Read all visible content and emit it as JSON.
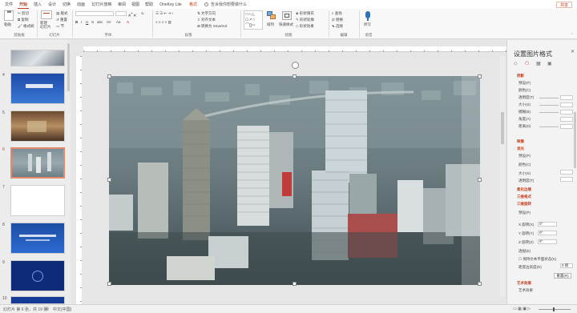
{
  "tabs": [
    "文件",
    "开始",
    "插入",
    "设计",
    "切换",
    "动画",
    "幻灯片放映",
    "审阅",
    "视图",
    "帮助",
    "OneKey Lite",
    "格式"
  ],
  "tell_me": "告诉我你想要做什么",
  "share": "共享",
  "ribbon": {
    "paste": "粘贴",
    "cut": "剪切",
    "copy": "复制",
    "format_painter": "格式刷",
    "new_slide": "新建\n幻灯片",
    "layout": "版式",
    "reset": "重置",
    "section": "节",
    "text_direction": "文字方向",
    "align_text": "对齐文本",
    "to_smartart": "转换为 SmartArt",
    "arrange": "排列",
    "quick_styles": "快速样式",
    "shape_fill": "形状填充",
    "shape_outline": "形状轮廓",
    "shape_effects": "形状效果",
    "find": "查找",
    "replace": "替换",
    "select": "选择",
    "dictate": "听写",
    "groups": {
      "clipboard": "剪贴板",
      "slides": "幻灯片",
      "font": "字体",
      "paragraph": "段落",
      "drawing": "绘图",
      "editing": "编辑",
      "voice": "语音"
    }
  },
  "slides": [
    {
      "num": "4"
    },
    {
      "num": "5"
    },
    {
      "num": "6"
    },
    {
      "num": "7"
    },
    {
      "num": "8"
    },
    {
      "num": "9"
    },
    {
      "num": "10"
    }
  ],
  "pane": {
    "title": "设置图片格式",
    "shadow": "阴影",
    "preset": "预设(P)",
    "color": "颜色(C)",
    "transparency": "透明度(T)",
    "size": "大小(S)",
    "blur": "模糊(B)",
    "angle": "角度(A)",
    "distance": "距离(D)",
    "reflection": "映像",
    "glow": "发光",
    "glow_preset": "预设(P)",
    "glow_color": "颜色(C)",
    "glow_size": "大小(S)",
    "glow_transparency": "透明度(T)",
    "soft_edges": "柔化边缘",
    "format3d": "三维格式",
    "rotation3d": "三维旋转",
    "rot_preset": "预设(P)",
    "x_rotation": "X 旋转(X)",
    "y_rotation": "Y 旋转(Y)",
    "z_rotation": "Z 旋转(Z)",
    "x_val": "0°",
    "y_val": "0°",
    "z_val": "0°",
    "perspective": "透视(E)",
    "keep_flat": "保持文本平面状态(K)",
    "dist_ground": "距底边高度(D)",
    "dist_val": "0 磅",
    "reset_btn": "重置(R)",
    "artistic": "艺术效果",
    "artistic2": "艺术效果"
  },
  "status": {
    "slide_info": "幻灯片 第 6 张，共 19 张",
    "lang": "中文(中国)"
  }
}
